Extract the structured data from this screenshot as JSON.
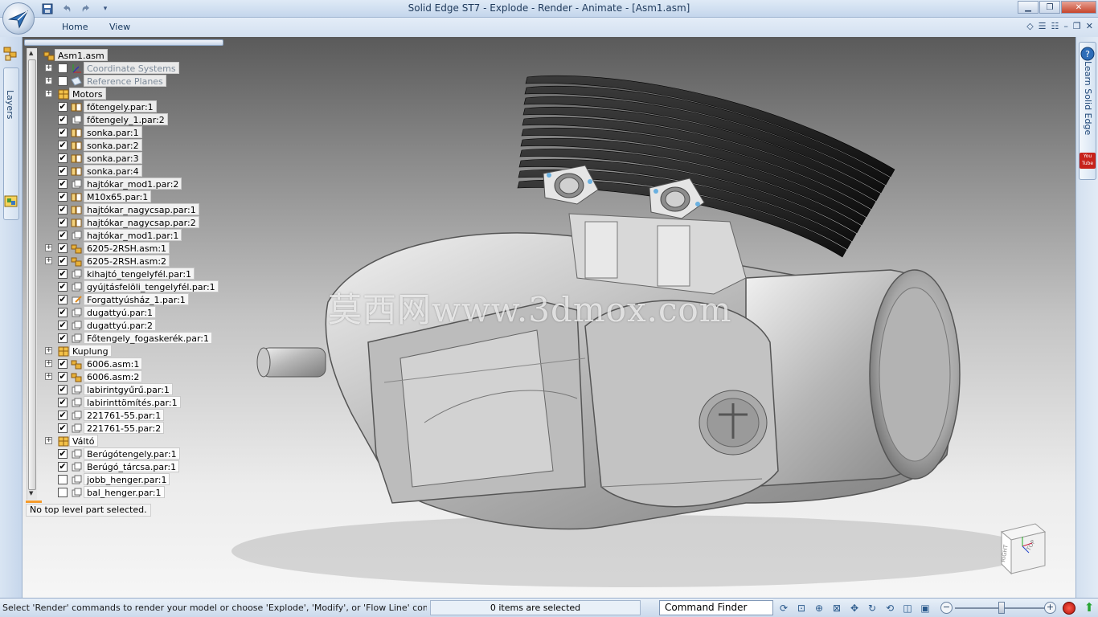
{
  "window": {
    "title": "Solid Edge ST7 - Explode - Render - Animate - [Asm1.asm]",
    "app_button_icon": "solid-edge-logo-icon",
    "quick_access": [
      "save-icon",
      "undo-icon",
      "redo-icon",
      "customize-icon"
    ],
    "controls": [
      "minimize-icon",
      "restore-icon",
      "close-icon"
    ]
  },
  "ribbon": {
    "tabs": [
      "Home",
      "View"
    ],
    "right_icons": [
      "diamond-icon",
      "list-icon",
      "list2-icon",
      "minimize-icon",
      "restore-icon",
      "close-icon"
    ]
  },
  "left_bar": {
    "top_icon": "assembly-icon",
    "layers_label": "Layers",
    "bottom_icon": "select-tools-icon"
  },
  "tree": {
    "root": "Asm1.asm",
    "items": [
      {
        "label": "Coordinate Systems",
        "level": 1,
        "expander": "+",
        "checked": false,
        "dim": true,
        "icon": "coordinate-system-icon"
      },
      {
        "label": "Reference Planes",
        "level": 1,
        "expander": "+",
        "checked": false,
        "dim": true,
        "icon": "reference-plane-icon"
      },
      {
        "label": "Motors",
        "level": 0,
        "expander": "+",
        "checked": null,
        "dim": false,
        "icon": "group-icon"
      },
      {
        "label": "főtengely.par:1",
        "level": 1,
        "expander": "",
        "checked": true,
        "dim": false,
        "icon": "part-ground-icon"
      },
      {
        "label": "főtengely_1.par:2",
        "level": 1,
        "expander": "",
        "checked": true,
        "dim": false,
        "icon": "part-icon"
      },
      {
        "label": "sonka.par:1",
        "level": 1,
        "expander": "",
        "checked": true,
        "dim": false,
        "icon": "part-ground-icon"
      },
      {
        "label": "sonka.par:2",
        "level": 1,
        "expander": "",
        "checked": true,
        "dim": false,
        "icon": "part-ground-icon"
      },
      {
        "label": "sonka.par:3",
        "level": 1,
        "expander": "",
        "checked": true,
        "dim": false,
        "icon": "part-ground-icon"
      },
      {
        "label": "sonka.par:4",
        "level": 1,
        "expander": "",
        "checked": true,
        "dim": false,
        "icon": "part-ground-icon"
      },
      {
        "label": "hajtókar_mod1.par:2",
        "level": 1,
        "expander": "",
        "checked": true,
        "dim": false,
        "icon": "part-icon"
      },
      {
        "label": "M10x65.par:1",
        "level": 1,
        "expander": "",
        "checked": true,
        "dim": false,
        "icon": "part-ground-icon"
      },
      {
        "label": "hajtókar_nagycsap.par:1",
        "level": 1,
        "expander": "",
        "checked": true,
        "dim": false,
        "icon": "part-ground-icon"
      },
      {
        "label": "hajtókar_nagycsap.par:2",
        "level": 1,
        "expander": "",
        "checked": true,
        "dim": false,
        "icon": "part-ground-icon"
      },
      {
        "label": "hajtókar_mod1.par:1",
        "level": 1,
        "expander": "",
        "checked": true,
        "dim": false,
        "icon": "part-icon"
      },
      {
        "label": "6205-2RSH.asm:1",
        "level": 1,
        "expander": "+",
        "checked": true,
        "dim": false,
        "icon": "subassembly-icon"
      },
      {
        "label": "6205-2RSH.asm:2",
        "level": 1,
        "expander": "+",
        "checked": true,
        "dim": false,
        "icon": "subassembly-icon"
      },
      {
        "label": "kihajtó_tengelyfél.par:1",
        "level": 1,
        "expander": "",
        "checked": true,
        "dim": false,
        "icon": "part-icon"
      },
      {
        "label": "gyújtásfelöli_tengelyfél.par:1",
        "level": 1,
        "expander": "",
        "checked": true,
        "dim": false,
        "icon": "part-icon"
      },
      {
        "label": "Forgattyúsház_1.par:1",
        "level": 1,
        "expander": "",
        "checked": true,
        "dim": false,
        "icon": "part-edit-icon"
      },
      {
        "label": "dugattyú.par:1",
        "level": 1,
        "expander": "",
        "checked": true,
        "dim": false,
        "icon": "part-icon"
      },
      {
        "label": "dugattyú.par:2",
        "level": 1,
        "expander": "",
        "checked": true,
        "dim": false,
        "icon": "part-icon"
      },
      {
        "label": "Főtengely_fogaskerék.par:1",
        "level": 1,
        "expander": "",
        "checked": true,
        "dim": false,
        "icon": "part-icon"
      },
      {
        "label": "Kuplung",
        "level": 0,
        "expander": "+",
        "checked": null,
        "dim": false,
        "icon": "group-icon"
      },
      {
        "label": "6006.asm:1",
        "level": 1,
        "expander": "+",
        "checked": true,
        "dim": false,
        "icon": "subassembly-icon"
      },
      {
        "label": "6006.asm:2",
        "level": 1,
        "expander": "+",
        "checked": true,
        "dim": false,
        "icon": "subassembly-icon"
      },
      {
        "label": "labirintgyűrű.par:1",
        "level": 1,
        "expander": "",
        "checked": true,
        "dim": false,
        "icon": "part-icon"
      },
      {
        "label": "labirinttömítés.par:1",
        "level": 1,
        "expander": "",
        "checked": true,
        "dim": false,
        "icon": "part-icon"
      },
      {
        "label": "221761-55.par:1",
        "level": 1,
        "expander": "",
        "checked": true,
        "dim": false,
        "icon": "part-icon"
      },
      {
        "label": "221761-55.par:2",
        "level": 1,
        "expander": "",
        "checked": true,
        "dim": false,
        "icon": "part-icon"
      },
      {
        "label": "Váltó",
        "level": 0,
        "expander": "+",
        "checked": null,
        "dim": false,
        "icon": "group-icon"
      },
      {
        "label": "Berúgótengely.par:1",
        "level": 1,
        "expander": "",
        "checked": true,
        "dim": false,
        "icon": "part-icon"
      },
      {
        "label": "Berúgó_tárcsa.par:1",
        "level": 1,
        "expander": "",
        "checked": true,
        "dim": false,
        "icon": "part-icon"
      },
      {
        "label": "jobb_henger.par:1",
        "level": 1,
        "expander": "",
        "checked": false,
        "dim": false,
        "icon": "part-icon"
      },
      {
        "label": "bal_henger.par:1",
        "level": 1,
        "expander": "",
        "checked": false,
        "dim": false,
        "icon": "part-icon"
      }
    ],
    "selection_status": "No top level part selected."
  },
  "viewport": {
    "watermark": "莫西网www.3dmox.com",
    "model": "engine-assembly-render",
    "view_cube_labels": [
      "RIGHT",
      "TOP"
    ],
    "view_cube_axis_labels": [
      "X",
      "Y",
      "Z"
    ]
  },
  "right_bar": {
    "learn_label": "Learn Solid Edge",
    "help_icon": "help-icon",
    "youtube_icon_text": "You Tube"
  },
  "status_bar": {
    "prompt": "Select 'Render' commands to render your model or choose 'Explode', 'Modify', or 'Flow Line' comma",
    "selection_count": "0 items are selected",
    "command_finder": "Command Finder",
    "tool_icons": [
      "refresh-icon",
      "zoom-area-icon",
      "zoom-icon",
      "fit-icon",
      "pan-icon",
      "rotate-icon",
      "spin-icon",
      "view-icon",
      "sheet-icon"
    ],
    "zoom_level": 0.52,
    "zoom_minus": "−",
    "zoom_plus": "+",
    "record_icon": "record-icon",
    "up_icon": "arrow-up-icon"
  },
  "colors": {
    "accent": "#f59b2b",
    "ui_frame": "#cfdbe9",
    "check_color": "#000000"
  }
}
